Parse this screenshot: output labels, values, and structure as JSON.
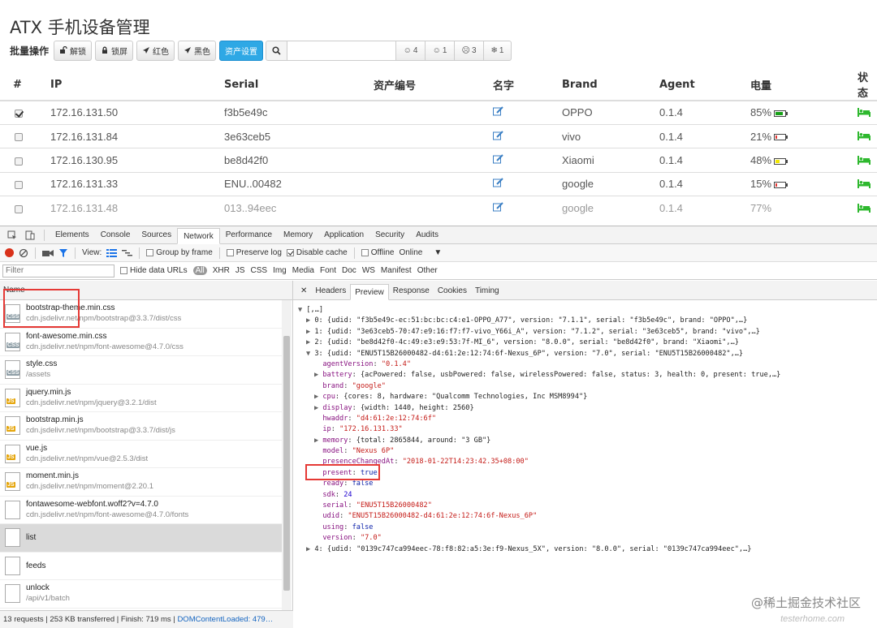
{
  "app": {
    "title": "ATX 手机设备管理",
    "toolbar": {
      "label": "批量操作",
      "buttons": [
        {
          "label": "解锁",
          "icon": "unlock-icon"
        },
        {
          "label": "锁屏",
          "icon": "lock-icon"
        },
        {
          "label": "红色",
          "icon": "plane-icon"
        },
        {
          "label": "黑色",
          "icon": "plane-icon"
        }
      ],
      "primary_button": "资产设置",
      "search_placeholder": "",
      "stats": [
        {
          "icon": "smile-icon",
          "value": "4"
        },
        {
          "icon": "meh-icon",
          "value": "1"
        },
        {
          "icon": "frown-icon",
          "value": "3"
        },
        {
          "icon": "snowflake-icon",
          "value": "1"
        }
      ]
    },
    "table": {
      "headers": [
        "#",
        "IP",
        "Serial",
        "资产编号",
        "名字",
        "Brand",
        "Agent",
        "电量",
        "状态"
      ],
      "rows": [
        {
          "checked": true,
          "ip": "172.16.131.50",
          "serial": "f3b5e49c",
          "asset": "",
          "brand": "OPPO",
          "agent": "0.1.4",
          "battery": "85%",
          "level": 0.85,
          "battery_color": "#16a116",
          "dim": false
        },
        {
          "checked": false,
          "ip": "172.16.131.84",
          "serial": "3e63ceb5",
          "asset": "",
          "brand": "vivo",
          "agent": "0.1.4",
          "battery": "21%",
          "level": 0.21,
          "battery_color": "#e53935",
          "dim": false
        },
        {
          "checked": false,
          "ip": "172.16.130.95",
          "serial": "be8d42f0",
          "asset": "",
          "brand": "Xiaomi",
          "agent": "0.1.4",
          "battery": "48%",
          "level": 0.48,
          "battery_color": "#f2e600",
          "dim": false
        },
        {
          "checked": false,
          "ip": "172.16.131.33",
          "serial": "ENU..00482",
          "asset": "",
          "brand": "google",
          "agent": "0.1.4",
          "battery": "15%",
          "level": 0.15,
          "battery_color": "#e53935",
          "dim": false
        },
        {
          "checked": false,
          "ip": "172.16.131.48",
          "serial": "013..94eec",
          "asset": "",
          "brand": "google",
          "agent": "0.1.4",
          "battery": "77%",
          "level": null,
          "battery_color": "",
          "dim": true
        }
      ]
    }
  },
  "devtools": {
    "tabs": [
      "Elements",
      "Console",
      "Sources",
      "Network",
      "Performance",
      "Memory",
      "Application",
      "Security",
      "Audits"
    ],
    "active_tab": "Network",
    "toolbar": {
      "view_label": "View:",
      "group_by_frame": "Group by frame",
      "preserve_log": "Preserve log",
      "disable_cache": "Disable cache",
      "offline": "Offline",
      "throttle": "Online"
    },
    "filter": {
      "placeholder": "Filter",
      "hide_data_urls": "Hide data URLs",
      "types": [
        "All",
        "XHR",
        "JS",
        "CSS",
        "Img",
        "Media",
        "Font",
        "Doc",
        "WS",
        "Manifest",
        "Other"
      ]
    },
    "name_header": "Name",
    "requests": [
      {
        "name": "bootstrap-theme.min.css",
        "url": "cdn.jsdelivr.net/npm/bootstrap@3.3.7/dist/css",
        "type": "CSS",
        "color": "#8e9ea6"
      },
      {
        "name": "font-awesome.min.css",
        "url": "cdn.jsdelivr.net/npm/font-awesome@4.7.0/css",
        "type": "CSS",
        "color": "#8e9ea6"
      },
      {
        "name": "style.css",
        "url": "/assets",
        "type": "CSS",
        "color": "#8e9ea6"
      },
      {
        "name": "jquery.min.js",
        "url": "cdn.jsdelivr.net/npm/jquery@3.2.1/dist",
        "type": "JS",
        "color": "#e5a50a"
      },
      {
        "name": "bootstrap.min.js",
        "url": "cdn.jsdelivr.net/npm/bootstrap@3.3.7/dist/js",
        "type": "JS",
        "color": "#e5a50a"
      },
      {
        "name": "vue.js",
        "url": "cdn.jsdelivr.net/npm/vue@2.5.3/dist",
        "type": "JS",
        "color": "#e5a50a"
      },
      {
        "name": "moment.min.js",
        "url": "cdn.jsdelivr.net/npm/moment@2.20.1",
        "type": "JS",
        "color": "#e5a50a"
      },
      {
        "name": "fontawesome-webfont.woff2?v=4.7.0",
        "url": "cdn.jsdelivr.net/npm/font-awesome@4.7.0/fonts",
        "type": "",
        "color": ""
      },
      {
        "name": "list",
        "url": "",
        "type": "",
        "color": "",
        "selected": true
      },
      {
        "name": "feeds",
        "url": "",
        "type": "",
        "color": ""
      },
      {
        "name": "unlock",
        "url": "/api/v1/batch",
        "type": "",
        "color": ""
      }
    ],
    "detail_tabs": [
      "Headers",
      "Preview",
      "Response",
      "Cookies",
      "Timing"
    ],
    "active_detail_tab": "Preview",
    "preview_lines": [
      {
        "indent": 0,
        "arrow": "▼",
        "text": "[,…]"
      },
      {
        "indent": 1,
        "arrow": "▶",
        "text": "0: {udid: \"f3b5e49c-ec:51:bc:bc:c4:e1-OPPO_A77\", version: \"7.1.1\", serial: \"f3b5e49c\", brand: \"OPPO\",…}"
      },
      {
        "indent": 1,
        "arrow": "▶",
        "text": "1: {udid: \"3e63ceb5-70:47:e9:16:f7:f7-vivo_Y66i_A\", version: \"7.1.2\", serial: \"3e63ceb5\", brand: \"vivo\",…}"
      },
      {
        "indent": 1,
        "arrow": "▶",
        "text": "2: {udid: \"be8d42f0-4c:49:e3:e9:53:7f-MI_6\", version: \"8.0.0\", serial: \"be8d42f0\", brand: \"Xiaomi\",…}"
      },
      {
        "indent": 1,
        "arrow": "▼",
        "text": "3: {udid: \"ENU5T15B26000482-d4:61:2e:12:74:6f-Nexus_6P\", version: \"7.0\", serial: \"ENU5T15B26000482\",…}"
      },
      {
        "indent": 2,
        "arrow": "",
        "key": "agentVersion",
        "val": "\"0.1.4\"",
        "vt": "s"
      },
      {
        "indent": 2,
        "arrow": "▶",
        "key": "battery",
        "val": "{acPowered: false, usbPowered: false, wirelessPowered: false, status: 3, health: 0, present: true,…}",
        "vt": "o"
      },
      {
        "indent": 2,
        "arrow": "",
        "key": "brand",
        "val": "\"google\"",
        "vt": "s"
      },
      {
        "indent": 2,
        "arrow": "▶",
        "key": "cpu",
        "val": "{cores: 8, hardware: \"Qualcomm Technologies, Inc MSM8994\"}",
        "vt": "o"
      },
      {
        "indent": 2,
        "arrow": "▶",
        "key": "display",
        "val": "{width: 1440, height: 2560}",
        "vt": "o"
      },
      {
        "indent": 2,
        "arrow": "",
        "key": "hwaddr",
        "val": "\"d4:61:2e:12:74:6f\"",
        "vt": "s"
      },
      {
        "indent": 2,
        "arrow": "",
        "key": "ip",
        "val": "\"172.16.131.33\"",
        "vt": "s"
      },
      {
        "indent": 2,
        "arrow": "▶",
        "key": "memory",
        "val": "{total: 2865844, around: \"3 GB\"}",
        "vt": "o"
      },
      {
        "indent": 2,
        "arrow": "",
        "key": "model",
        "val": "\"Nexus 6P\"",
        "vt": "s"
      },
      {
        "indent": 2,
        "arrow": "",
        "key": "presenceChangedAt",
        "val": "\"2018-01-22T14:23:42.35+08:00\"",
        "vt": "s"
      },
      {
        "indent": 2,
        "arrow": "",
        "key": "present",
        "val": "true",
        "vt": "b"
      },
      {
        "indent": 2,
        "arrow": "",
        "key": "ready",
        "val": "false",
        "vt": "b"
      },
      {
        "indent": 2,
        "arrow": "",
        "key": "sdk",
        "val": "24",
        "vt": "n"
      },
      {
        "indent": 2,
        "arrow": "",
        "key": "serial",
        "val": "\"ENU5T15B26000482\"",
        "vt": "s"
      },
      {
        "indent": 2,
        "arrow": "",
        "key": "udid",
        "val": "\"ENU5T15B26000482-d4:61:2e:12:74:6f-Nexus_6P\"",
        "vt": "s"
      },
      {
        "indent": 2,
        "arrow": "",
        "key": "using",
        "val": "false",
        "vt": "b"
      },
      {
        "indent": 2,
        "arrow": "",
        "key": "version",
        "val": "\"7.0\"",
        "vt": "s"
      },
      {
        "indent": 1,
        "arrow": "▶",
        "text": "4: {udid: \"0139c747ca994eec-78:f8:82:a5:3e:f9-Nexus_5X\", version: \"8.0.0\", serial: \"0139c747ca994eec\",…}"
      }
    ],
    "status": {
      "requests": "13 requests",
      "transferred": "253 KB transferred",
      "finish": "Finish: 719 ms",
      "dom": "DOMContentLoaded: 479…"
    }
  },
  "watermark": {
    "main": "@稀土掘金技术社区",
    "sub": "testerhome.com"
  }
}
